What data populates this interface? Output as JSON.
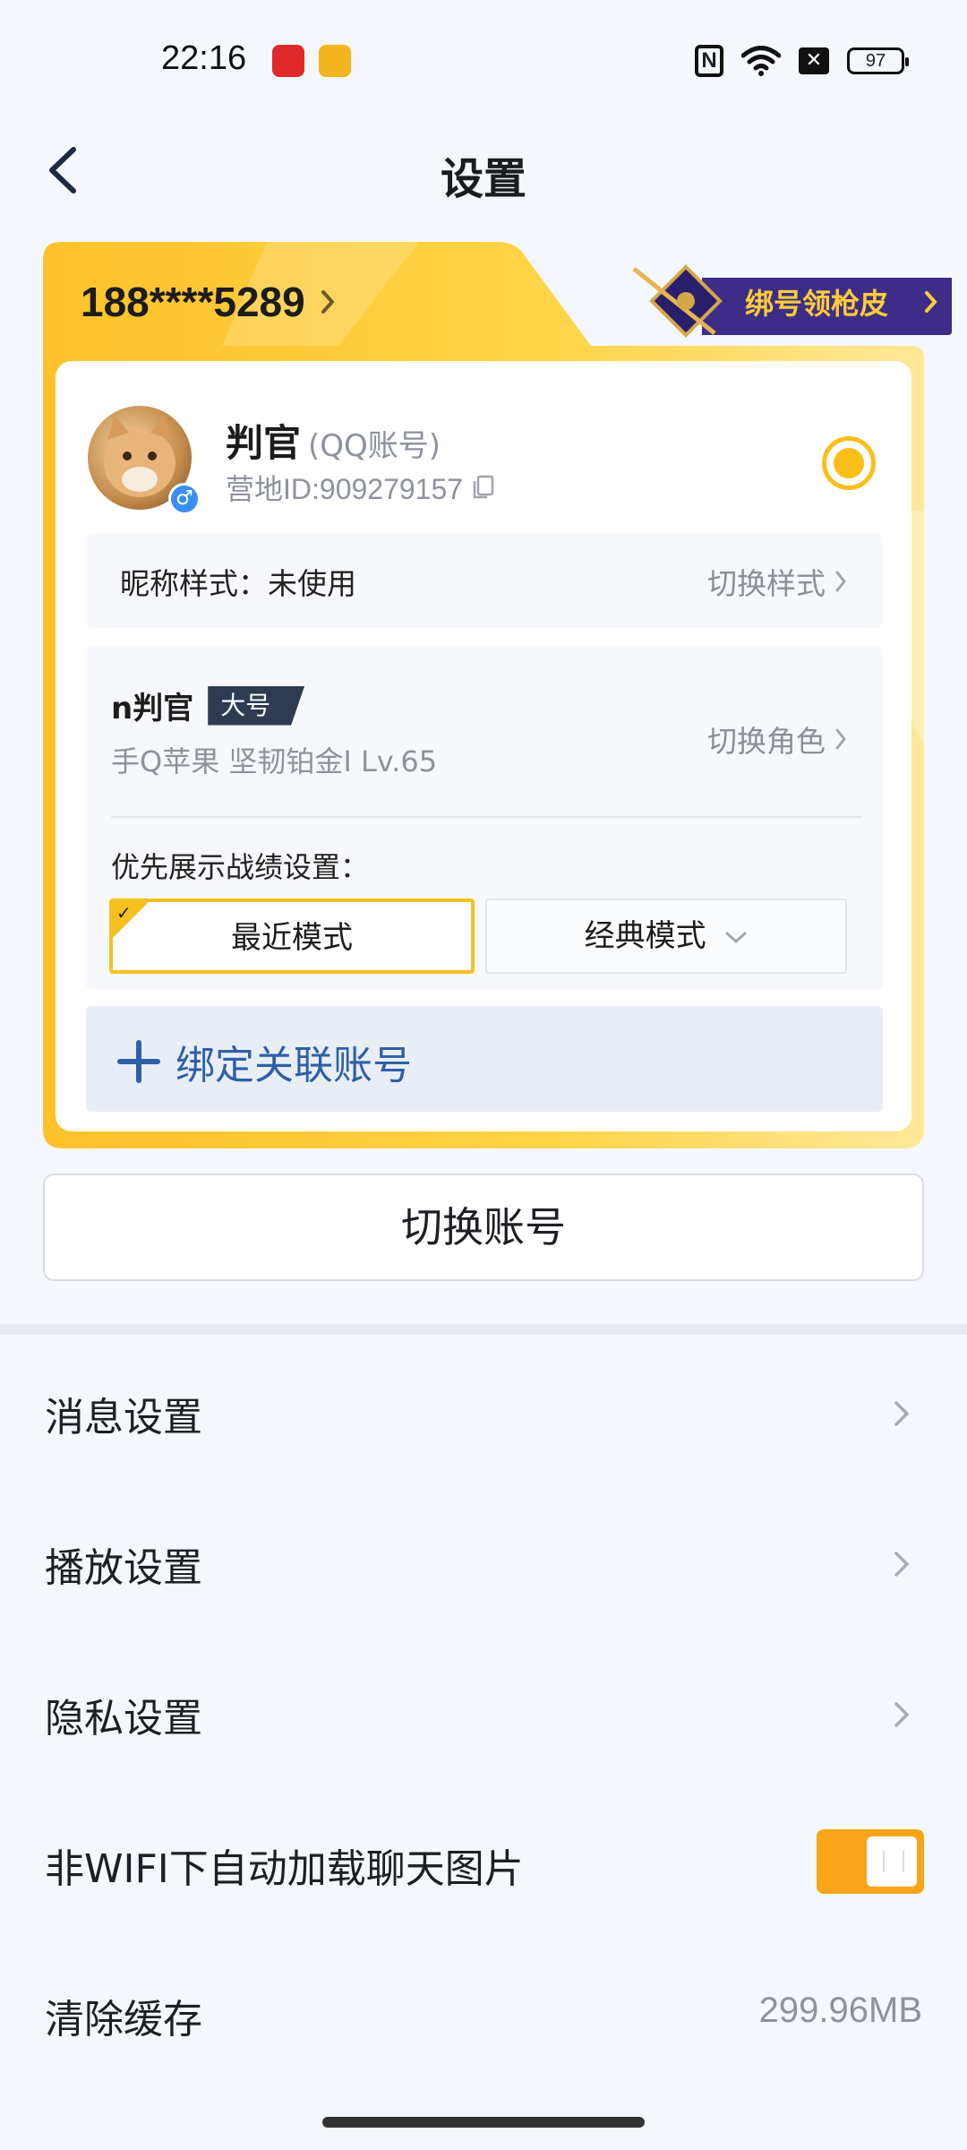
{
  "status_bar": {
    "time": "22:16",
    "battery": "97",
    "icons": [
      "app-red-icon",
      "app-yellow-icon",
      "nfc-icon",
      "wifi-icon",
      "sim-off-icon",
      "battery-icon"
    ]
  },
  "header": {
    "title": "设置",
    "back_icon": "chevron-left-icon"
  },
  "account": {
    "phone": "188****5289",
    "bind_badge": "绑号领枪皮",
    "name": "判官",
    "account_type": "(QQ账号)",
    "camp_id": "营地ID:909279157",
    "nickname_style": "昵称样式：未使用",
    "switch_style": "切换样式",
    "role": {
      "name": "n判官",
      "tag": "大号",
      "detail": "手Q苹果  坚韧铂金I  Lv.65",
      "switch_role": "切换角色"
    },
    "priority_label": "优先展示战绩设置：",
    "modes": {
      "recent": "最近模式",
      "classic": "经典模式"
    },
    "bind_associated": "绑定关联账号",
    "accent_color": "#fbbf19"
  },
  "switch_account": "切换账号",
  "settings": [
    {
      "label": "消息设置"
    },
    {
      "label": "播放设置"
    },
    {
      "label": "隐私设置"
    },
    {
      "label": "非WIFI下自动加载聊天图片",
      "toggle": true
    },
    {
      "label": "清除缓存",
      "value": "299.96MB"
    }
  ]
}
